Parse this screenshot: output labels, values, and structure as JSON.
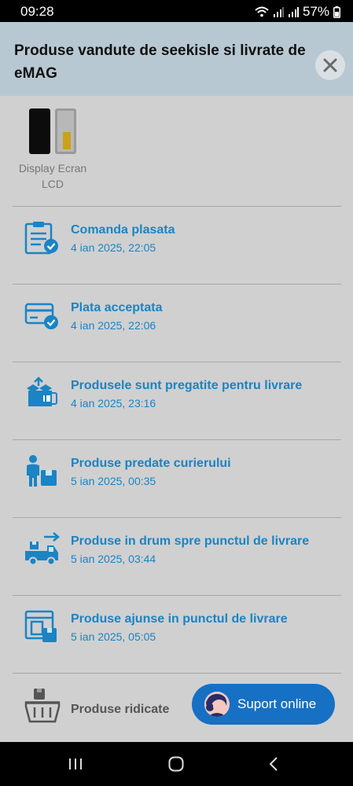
{
  "status": {
    "time": "09:28",
    "battery": "57%"
  },
  "header": {
    "title": "Produse vandute de seekisle si livrate de eMAG"
  },
  "product": {
    "label": "Display Ecran LCD"
  },
  "steps": [
    {
      "title": "Comanda plasata",
      "date": "4 ian 2025, 22:05",
      "icon": "clipboard-check-icon"
    },
    {
      "title": "Plata acceptata",
      "date": "4 ian 2025, 22:06",
      "icon": "card-check-icon"
    },
    {
      "title": "Produsele sunt pregatite pentru livrare",
      "date": "4 ian 2025, 23:16",
      "icon": "open-box-icon"
    },
    {
      "title": "Produse predate curierului",
      "date": "5 ian 2025, 00:35",
      "icon": "courier-icon"
    },
    {
      "title": "Produse in drum spre punctul de livrare",
      "date": "5 ian 2025, 03:44",
      "icon": "delivery-truck-icon"
    },
    {
      "title": "Produse ajunse in punctul de livrare",
      "date": "5 ian 2025, 05:05",
      "icon": "pickup-point-icon"
    },
    {
      "title": "Produse ridicate",
      "icon": "basket-icon"
    }
  ],
  "support": {
    "label": "Suport online"
  },
  "colors": {
    "accent": "#1a84c4",
    "support_button": "#1670c4",
    "header_bg": "#b7c8d2"
  }
}
